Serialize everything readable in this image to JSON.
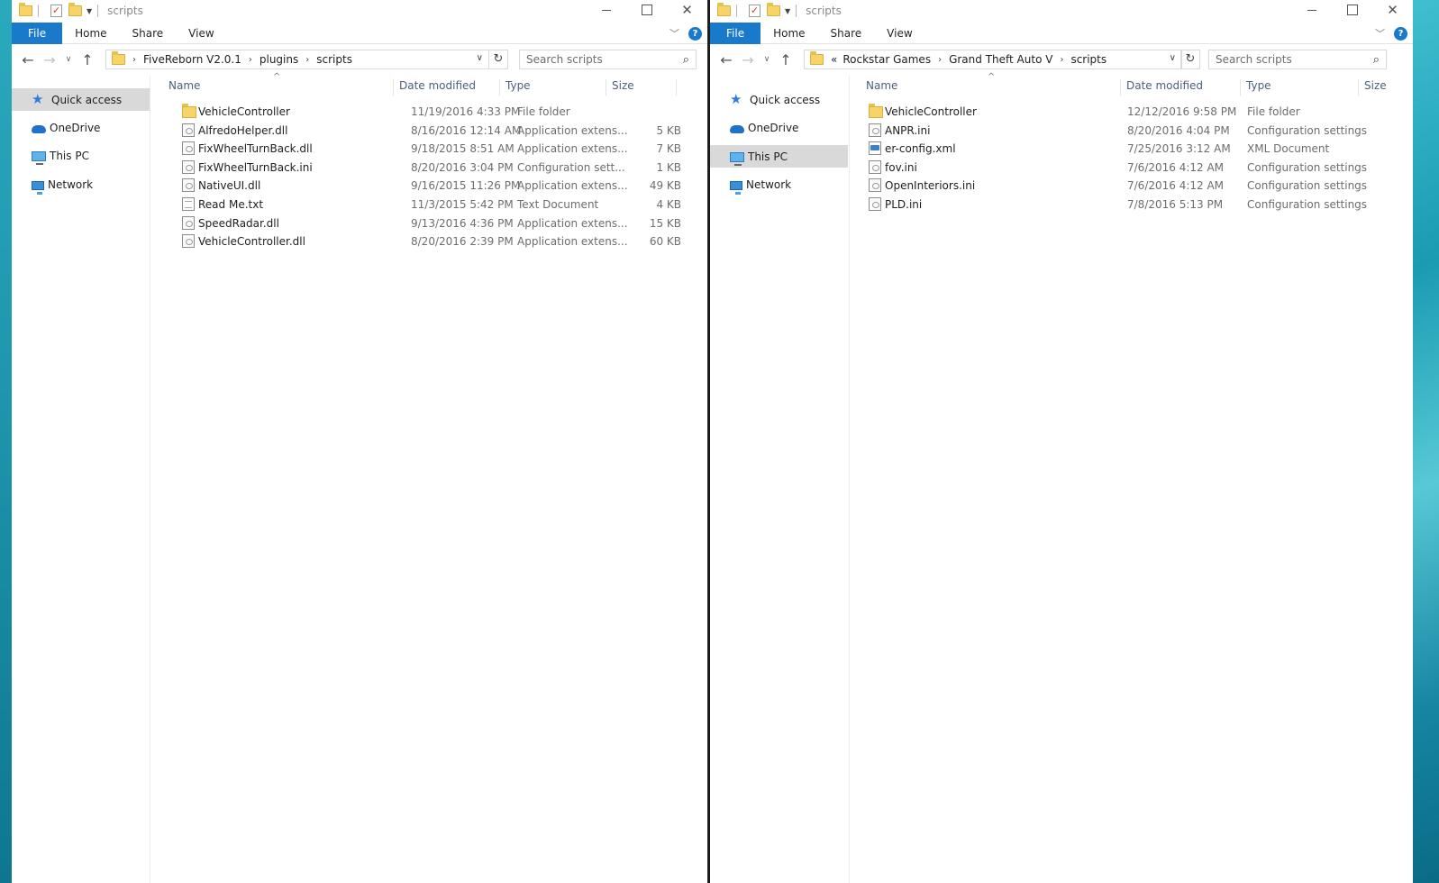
{
  "left": {
    "title": "scripts",
    "ribbon": {
      "file": "File",
      "home": "Home",
      "share": "Share",
      "view": "View"
    },
    "breadcrumb": [
      "FiveReborn V2.0.1",
      "plugins",
      "scripts"
    ],
    "search_placeholder": "Search scripts",
    "nav": [
      "Quick access",
      "OneDrive",
      "This PC",
      "Network"
    ],
    "columns": {
      "name": "Name",
      "date": "Date modified",
      "type": "Type",
      "size": "Size"
    },
    "files": [
      {
        "name": "VehicleController",
        "date": "11/19/2016 4:33 PM",
        "type": "File folder",
        "size": "",
        "icon": "folder"
      },
      {
        "name": "AlfredoHelper.dll",
        "date": "8/16/2016 12:14 AM",
        "type": "Application extens...",
        "size": "5 KB",
        "icon": "dll"
      },
      {
        "name": "FixWheelTurnBack.dll",
        "date": "9/18/2015 8:51 AM",
        "type": "Application extens...",
        "size": "7 KB",
        "icon": "dll"
      },
      {
        "name": "FixWheelTurnBack.ini",
        "date": "8/20/2016 3:04 PM",
        "type": "Configuration sett...",
        "size": "1 KB",
        "icon": "ini"
      },
      {
        "name": "NativeUI.dll",
        "date": "9/16/2015 11:26 PM",
        "type": "Application extens...",
        "size": "49 KB",
        "icon": "dll"
      },
      {
        "name": "Read Me.txt",
        "date": "11/3/2015 5:42 PM",
        "type": "Text Document",
        "size": "4 KB",
        "icon": "txt"
      },
      {
        "name": "SpeedRadar.dll",
        "date": "9/13/2016 4:36 PM",
        "type": "Application extens...",
        "size": "15 KB",
        "icon": "dll"
      },
      {
        "name": "VehicleController.dll",
        "date": "8/20/2016 2:39 PM",
        "type": "Application extens...",
        "size": "60 KB",
        "icon": "dll"
      }
    ]
  },
  "right": {
    "title": "scripts",
    "ribbon": {
      "file": "File",
      "home": "Home",
      "share": "Share",
      "view": "View"
    },
    "breadcrumb_overflow": "«",
    "breadcrumb": [
      "Rockstar Games",
      "Grand Theft Auto V",
      "scripts"
    ],
    "search_placeholder": "Search scripts",
    "nav": [
      "Quick access",
      "OneDrive",
      "This PC",
      "Network"
    ],
    "columns": {
      "name": "Name",
      "date": "Date modified",
      "type": "Type",
      "size": "Size"
    },
    "files": [
      {
        "name": "VehicleController",
        "date": "12/12/2016 9:58 PM",
        "type": "File folder",
        "icon": "folder"
      },
      {
        "name": "ANPR.ini",
        "date": "8/20/2016 4:04 PM",
        "type": "Configuration settings",
        "icon": "ini"
      },
      {
        "name": "er-config.xml",
        "date": "7/25/2016 3:12 AM",
        "type": "XML Document",
        "icon": "xml"
      },
      {
        "name": "fov.ini",
        "date": "7/6/2016 4:12 AM",
        "type": "Configuration settings",
        "icon": "ini"
      },
      {
        "name": "OpenInteriors.ini",
        "date": "7/6/2016 4:12 AM",
        "type": "Configuration settings",
        "icon": "ini"
      },
      {
        "name": "PLD.ini",
        "date": "7/8/2016 5:13 PM",
        "type": "Configuration settings",
        "icon": "ini"
      }
    ]
  },
  "accent_color": "#1979ca",
  "selection_color": "#cce8ff"
}
